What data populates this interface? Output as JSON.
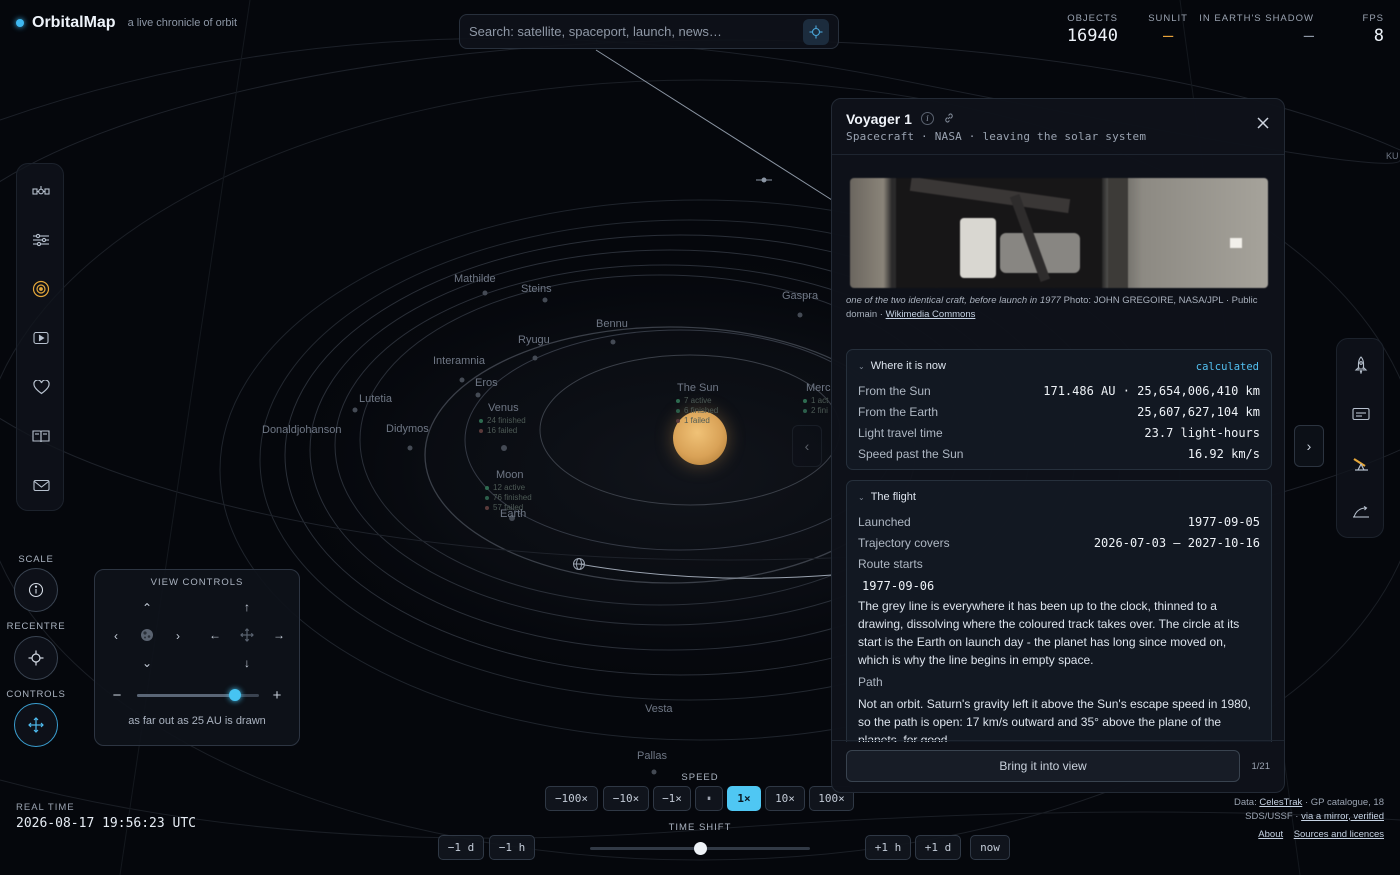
{
  "app": {
    "name": "OrbitalMap",
    "tagline": "a live chronicle of orbit"
  },
  "search": {
    "placeholder": "Search: satellite, spaceport, launch, news…",
    "value": ""
  },
  "stats": [
    {
      "label": "OBJECTS",
      "value": "16940"
    },
    {
      "label": "SUNLIT",
      "value": "–"
    },
    {
      "label": "IN EARTH'S SHADOW",
      "value": "–"
    },
    {
      "label": "FPS",
      "value": "8"
    }
  ],
  "left_rail": {
    "items": [
      {
        "icon": "satellite-icon"
      },
      {
        "icon": "sliders-icon"
      },
      {
        "icon": "target-icon"
      },
      {
        "icon": "play-icon"
      },
      {
        "icon": "heart-icon"
      },
      {
        "icon": "book-icon"
      },
      {
        "icon": "mail-icon"
      }
    ]
  },
  "right_rail": {
    "items": [
      {
        "icon": "rocket-icon"
      },
      {
        "icon": "card-icon"
      },
      {
        "icon": "telescope-icon"
      },
      {
        "icon": "trajectory-icon"
      }
    ]
  },
  "side_controls": {
    "scale_label": "SCALE",
    "recentre_label": "RECENTRE",
    "controls_label": "CONTROLS"
  },
  "view_controls": {
    "title": "VIEW CONTROLS",
    "zoom_fraction": 0.8,
    "caption": "as far out as 25 AU is drawn"
  },
  "scene": {
    "labels": [
      "Mathilde",
      "Steins",
      "Gaspra",
      "Bennu",
      "Ryugu",
      "Interamnia",
      "Eros",
      "Lutetia",
      "Venus",
      "Donaldjohanson",
      "Didymos",
      "Moon",
      "Earth",
      "The Sun",
      "Merc",
      "Vesta",
      "Pallas",
      "KU"
    ],
    "sun_stats": [
      "7 active",
      "6 finished",
      "1 failed"
    ],
    "venus_stats": [
      "24 finished",
      "16 failed"
    ],
    "moon_stats": [
      "12 active",
      "76 finished",
      "57 failed"
    ],
    "merc_stats": [
      "1 act",
      "2 fini"
    ]
  },
  "time": {
    "realtime_label": "REAL TIME",
    "realtime_value": "2026-08-17 19:56:23 UTC",
    "speed_label": "SPEED",
    "speeds": [
      "−100×",
      "−10×",
      "−1×",
      "⏸",
      "1×",
      "10×",
      "100×"
    ],
    "active_speed": "1×",
    "shift_label": "TIME SHIFT",
    "shift_back": [
      "−1 d",
      "−1 h"
    ],
    "shift_forward": [
      "+1 h",
      "+1 d",
      "now"
    ],
    "shift_fraction": 0.5
  },
  "credits": {
    "prefix": "Data: ",
    "source_link": "CelesTrak",
    "line1_rest": " · GP catalogue, 18",
    "line2_prefix": "SDS/USSF · ",
    "mirror_link": "via a mirror, verified",
    "about": "About",
    "licences": "Sources and licences"
  },
  "panel": {
    "title": "Voyager 1",
    "subtitle": "Spacecraft · NASA · leaving the solar system",
    "photo_caption_italic": "one of the two identical craft, before launch in 1977",
    "photo_caption_credit": " Photo: JOHN GREGOIRE, NASA/JPL · Public domain · ",
    "photo_caption_link": "Wikimedia Commons",
    "where": {
      "title": "Where it is now",
      "badge": "calculated",
      "rows": [
        {
          "k": "From the Sun",
          "v": "171.486 AU · 25,654,006,410 km"
        },
        {
          "k": "From the Earth",
          "v": "25,607,627,104 km"
        },
        {
          "k": "Light travel time",
          "v": "23.7 light-hours"
        },
        {
          "k": "Speed past the Sun",
          "v": "16.92 km/s"
        }
      ]
    },
    "flight": {
      "title": "The flight",
      "rows": [
        {
          "k": "Launched",
          "v": "1977-09-05"
        },
        {
          "k": "Trajectory covers",
          "v": "2026-07-03 – 2027-10-16"
        }
      ],
      "route_label": "Route starts",
      "route_value": "1977-09-06",
      "route_text": "The grey line is everywhere it has been up to the clock, thinned to a drawing, dissolving where the coloured track takes over. The circle at its start is the Earth on launch day - the planet has long since moved on, which is why the line begins in empty space.",
      "path_label": "Path",
      "path_text": "Not an orbit. Saturn's gravity left it above the Sun's escape speed in 1980, so the path is open: 17 km/s outward and 35° above the plane of the planets, for good."
    },
    "bring_button": "Bring it into view",
    "pager": "1/21"
  }
}
